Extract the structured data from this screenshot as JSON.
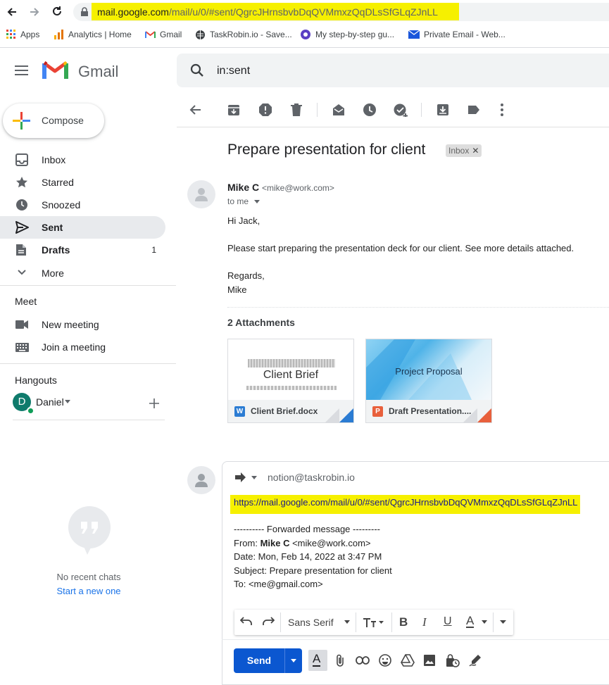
{
  "browser": {
    "url_host": "mail.google.com",
    "url_path": "/mail/u/0/#sent/QgrcJHrnsbvbDqQVMmxzQqDLsSfGLqZJnLL",
    "bookmarks": [
      {
        "label": "Apps",
        "icon": "apps-grid-icon"
      },
      {
        "label": "Analytics | Home",
        "icon": "analytics-icon"
      },
      {
        "label": "Gmail",
        "icon": "gmail-icon"
      },
      {
        "label": "TaskRobin.io - Save...",
        "icon": "globe-icon"
      },
      {
        "label": "My step-by-step gu...",
        "icon": "guide-icon"
      },
      {
        "label": "Private Email - Web...",
        "icon": "email-icon"
      }
    ]
  },
  "header": {
    "app_name": "Gmail",
    "search_value": "in:sent"
  },
  "sidebar": {
    "compose_label": "Compose",
    "items": [
      {
        "label": "Inbox",
        "icon": "inbox-icon",
        "count": ""
      },
      {
        "label": "Starred",
        "icon": "star-icon",
        "count": ""
      },
      {
        "label": "Snoozed",
        "icon": "clock-icon",
        "count": ""
      },
      {
        "label": "Sent",
        "icon": "send-icon",
        "count": ""
      },
      {
        "label": "Drafts",
        "icon": "draft-icon",
        "count": "1"
      },
      {
        "label": "More",
        "icon": "chevron-down-icon",
        "count": ""
      }
    ],
    "meet_title": "Meet",
    "meet_items": [
      {
        "label": "New meeting",
        "icon": "video-icon"
      },
      {
        "label": "Join a meeting",
        "icon": "keyboard-icon"
      }
    ],
    "hangouts_title": "Hangouts",
    "hangouts_user": "Daniel",
    "hangouts_user_initial": "D",
    "no_chats": "No recent chats",
    "start_new": "Start a new one"
  },
  "message": {
    "subject": "Prepare presentation for client",
    "label_badge": "Inbox",
    "sender_name": "Mike C",
    "sender_email": "<mike@work.com>",
    "to_line": "to me",
    "body": [
      "Hi Jack,",
      "Please start preparing the presentation deck for our client. See more details attached.",
      "Regards,",
      "Mike"
    ],
    "attachments_title": "2 Attachments",
    "attachments": [
      {
        "name": "Client Brief.docx",
        "preview_title": "Client Brief",
        "type_letter": "W",
        "color": "#2b7cd3"
      },
      {
        "name": "Draft Presentation....",
        "preview_title": "Project Proposal",
        "type_letter": "P",
        "color": "#e8603c"
      }
    ]
  },
  "reply": {
    "to": "notion@taskrobin.io",
    "link": "https://mail.google.com/mail/u/0/#sent/QgrcJHrnsbvbDqQVMmxzQqDLsSfGLqZJnLL",
    "fwd_header": "---------- Forwarded message ---------",
    "from_label": "From: ",
    "from_name": "Mike C",
    "from_email": " <mike@work.com>",
    "date": "Date: Mon, Feb 14, 2022 at 3:47 PM",
    "subject": "Subject: Prepare presentation for client",
    "to_line": "To: <me@gmail.com>",
    "font_name": "Sans Serif",
    "send_label": "Send"
  },
  "colors": {
    "accent": "#0b57d0",
    "highlight": "#f6f000",
    "selected": "#e8eaed"
  }
}
